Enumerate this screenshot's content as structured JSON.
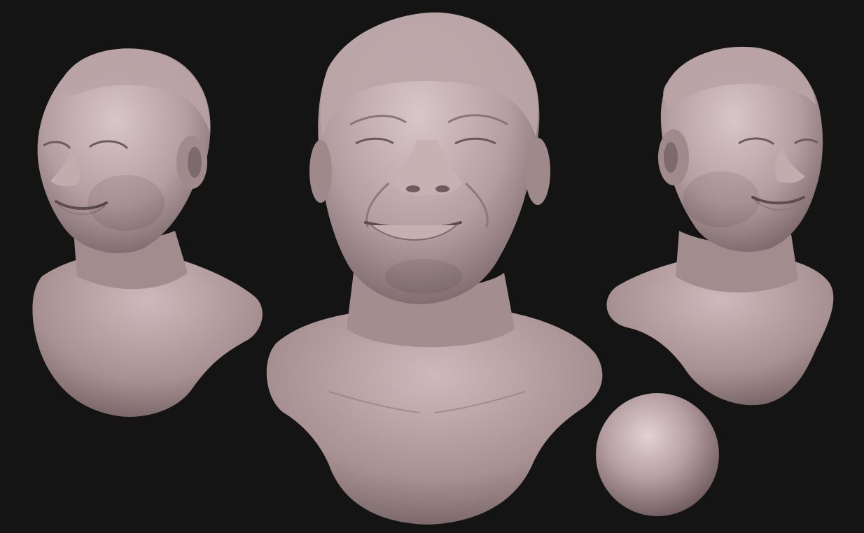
{
  "scene": {
    "subject": "sculpted-bust-render",
    "views": [
      "left-three-quarter",
      "front",
      "right-three-quarter"
    ],
    "material_preview": "sphere"
  },
  "colors": {
    "background": "#141414",
    "clay_light": "#c9b3b5",
    "clay_mid": "#9c8688",
    "clay_dark": "#5e4e50",
    "clay_highlight": "#dccbcd"
  }
}
